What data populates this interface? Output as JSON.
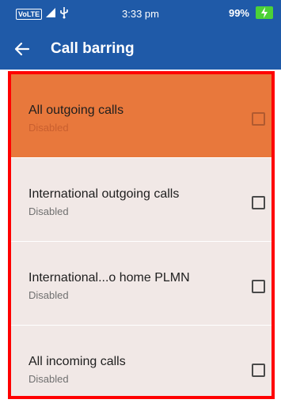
{
  "status_bar": {
    "volte_label": "VoLTE",
    "time": "3:33 pm",
    "battery": "99%",
    "colors": {
      "background": "#1f5aa8",
      "battery": "#4cd137"
    }
  },
  "app_bar": {
    "title": "Call barring",
    "back_icon": "arrow-left-icon"
  },
  "call_barring_items": [
    {
      "title": "All outgoing calls",
      "status": "Disabled",
      "checked": false,
      "highlighted": true
    },
    {
      "title": "International outgoing calls",
      "status": "Disabled",
      "checked": false,
      "highlighted": false
    },
    {
      "title": "International...o home PLMN",
      "status": "Disabled",
      "checked": false,
      "highlighted": false
    },
    {
      "title": "All incoming calls",
      "status": "Disabled",
      "checked": false,
      "highlighted": false
    }
  ],
  "colors": {
    "highlight": "#e8783c",
    "row_background": "#f1e8e6",
    "selection_border": "#ff0000"
  }
}
